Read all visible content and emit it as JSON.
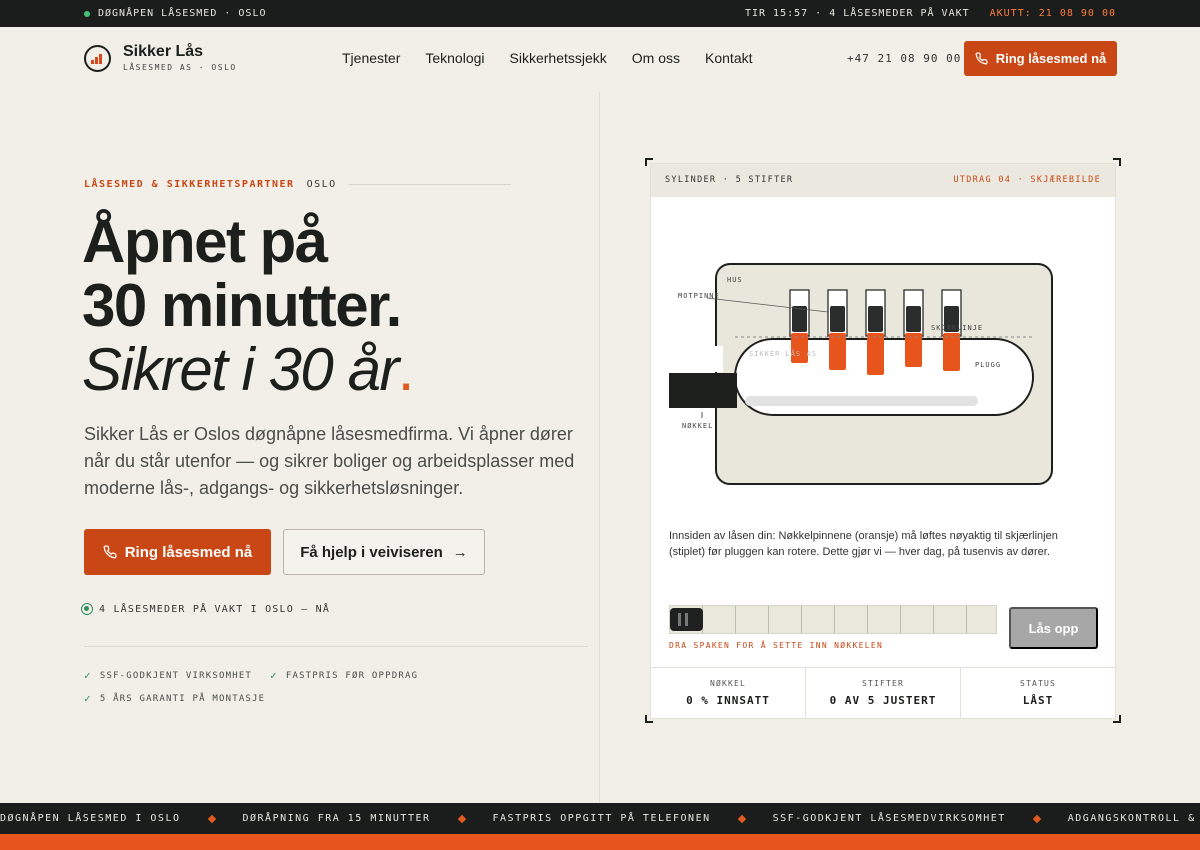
{
  "topbar": {
    "open_status": "DØGNÅPEN LÅSESMED · OSLO",
    "time_status": "TIR 15:57 · 4 LÅSESMEDER PÅ VAKT",
    "emergency": "AKUTT: 21 08 90 00"
  },
  "brand": {
    "name": "Sikker Lås",
    "subtitle": "LÅSESMED AS · OSLO"
  },
  "nav": {
    "items": [
      "Tjenester",
      "Teknologi",
      "Sikkerhetssjekk",
      "Om oss",
      "Kontakt"
    ],
    "phone": "+47 21 08 90 00",
    "cta": "Ring låsesmed nå"
  },
  "hero": {
    "eyebrow_accent": "LÅSESMED & SIKKERHETSPARTNER",
    "eyebrow_city": "OSLO",
    "headline_1": "Åpnet på",
    "headline_2": "30 minutter.",
    "headline_3": "Sikret i 30 år",
    "headline_period": ".",
    "lede": "Sikker Lås er Oslos døgnåpne låsesmedfirma. Vi åpner dører når du står utenfor — og sikrer boliger og arbeidsplasser med moderne lås-, adgangs- og sikkerhetsløsninger.",
    "cta_primary": "Ring låsesmed nå",
    "cta_secondary": "Få hjelp i veiviseren",
    "cta_secondary_arrow": "→",
    "on_duty": "4 LÅSESMEDER PÅ VAKT I OSLO — NÅ",
    "features": [
      "SSF-GODKJENT VIRKSOMHET",
      "FASTPRIS FØR OPPDRAG",
      "5 ÅRS GARANTI PÅ MONTASJE"
    ]
  },
  "card": {
    "header_left": "SYLINDER · 5 STIFTER",
    "header_right": "UTDRAG 04 · SKJÆREBILDE",
    "labels": {
      "hus": "HUS",
      "motpinne": "MOTPINNE",
      "skjaerlinje": "SKJÆRLINJE",
      "sikkerlas": "SIKKER LÅS AS",
      "plugg": "PLUGG",
      "nokkel": "NØKKEL"
    },
    "pins": 5,
    "description": "Innsiden av låsen din: Nøkkelpinnene (oransje) må løftes nøyaktig til skjærlinjen (stiplet) før pluggen kan rotere. Dette gjør vi — hver dag, på tusenvis av dører.",
    "slider_hint": "DRA SPAKEN FOR Å SETTE INN NØKKELEN",
    "slider_progress": 0,
    "unlock_button": "Lås opp",
    "stats": [
      {
        "label": "NØKKEL",
        "value": "0 % INNSATT"
      },
      {
        "label": "STIFTER",
        "value": "0 AV 5 JUSTERT"
      },
      {
        "label": "STATUS",
        "value": "LÅST"
      }
    ]
  },
  "ticker": [
    "DØGNÅPEN LÅSESMED I OSLO",
    "DØRÅPNING FRA 15 MINUTTER",
    "FASTPRIS OPPGITT PÅ TELEFONEN",
    "SSF-GODKJENT LÅSESMEDVIRKSOMHET",
    "ADGANGSKONTROLL & SMARTE LÅS"
  ],
  "colors": {
    "accent": "#c94714",
    "accent_bright": "#e8551c",
    "dark": "#1a1d1b",
    "background": "#f2efe9",
    "online": "#2f8f5b"
  }
}
